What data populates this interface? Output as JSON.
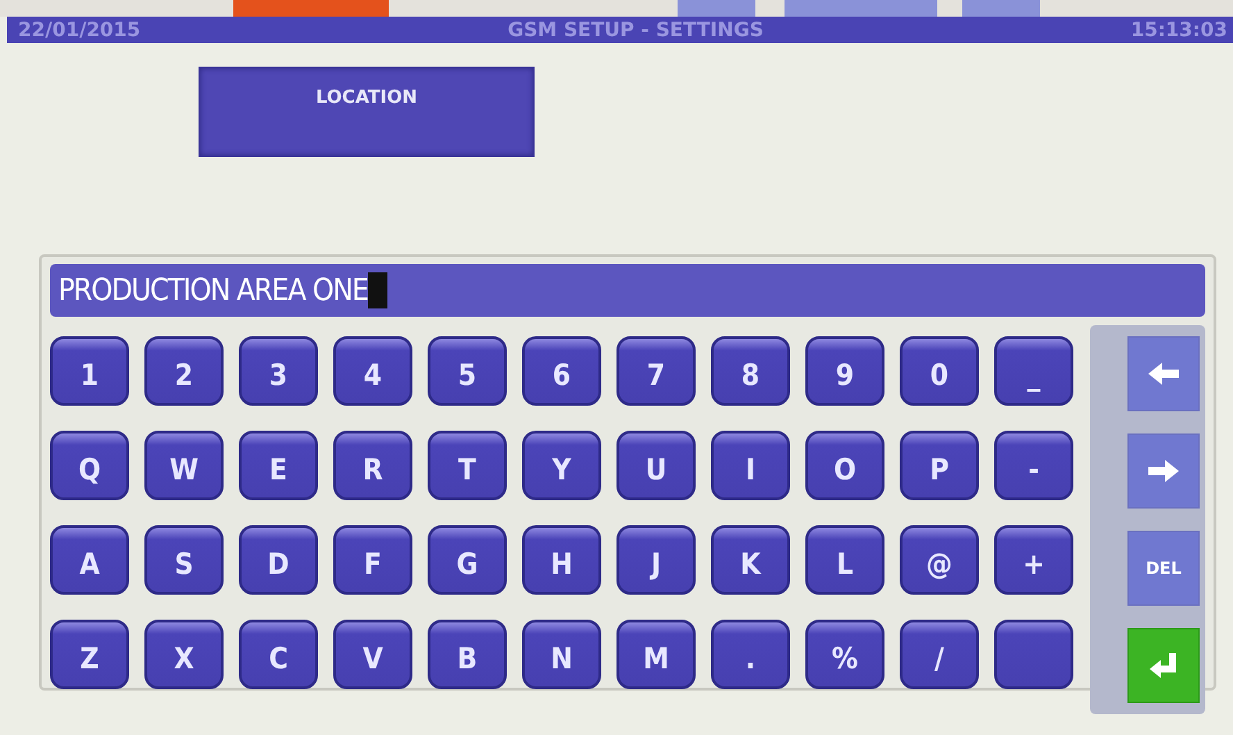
{
  "header": {
    "date": "22/01/2015",
    "title": "GSM SETUP - SETTINGS",
    "time": "15:13:03"
  },
  "field_button": {
    "label": "LOCATION"
  },
  "input": {
    "value": "PRODUCTION AREA ONE"
  },
  "keys": [
    [
      "1",
      "2",
      "3",
      "4",
      "5",
      "6",
      "7",
      "8",
      "9",
      "0",
      "_"
    ],
    [
      "Q",
      "W",
      "E",
      "R",
      "T",
      "Y",
      "U",
      "I",
      "O",
      "P",
      "-"
    ],
    [
      "A",
      "S",
      "D",
      "F",
      "G",
      "H",
      "J",
      "K",
      "L",
      "@",
      "+"
    ],
    [
      "Z",
      "X",
      "C",
      "V",
      "B",
      "N",
      "M",
      ".",
      "%",
      "/",
      {
        "kind": "space"
      }
    ]
  ],
  "side_keys": [
    {
      "kind": "left"
    },
    {
      "kind": "right"
    },
    {
      "kind": "text",
      "label": "DEL"
    },
    {
      "kind": "enter"
    }
  ]
}
